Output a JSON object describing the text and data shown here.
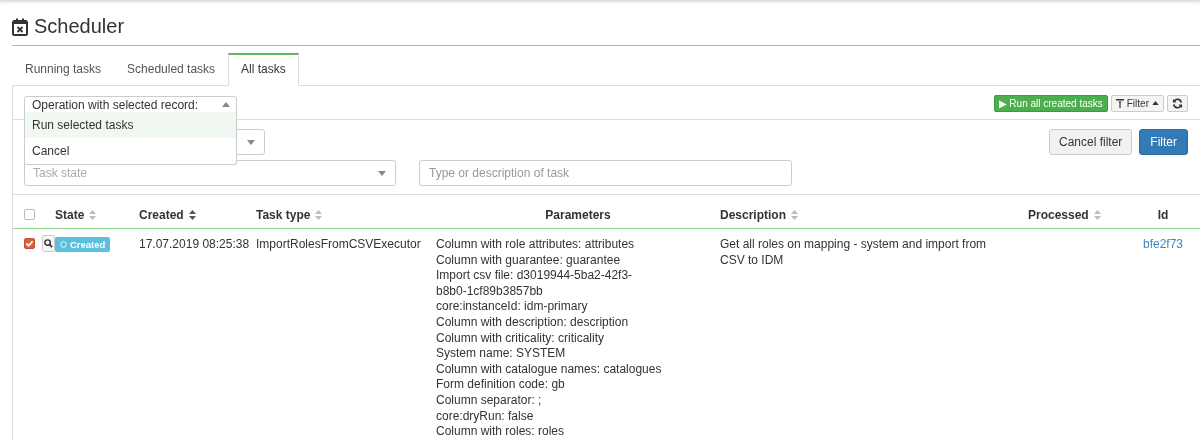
{
  "page": {
    "title": "Scheduler"
  },
  "tabs": [
    {
      "label": "Running tasks",
      "selected": false
    },
    {
      "label": "Scheduled tasks",
      "selected": false
    },
    {
      "label": "All tasks",
      "selected": true
    }
  ],
  "operation": {
    "label": "Operation with selected record:",
    "expanded": true,
    "options": [
      {
        "label": "Run selected tasks",
        "selected": true
      },
      {
        "label": "Cancel",
        "selected": false
      }
    ]
  },
  "toolbar": {
    "run_all": "▶ Run all created tasks",
    "filter_toggle": "Filter",
    "filter_expanded": true
  },
  "filter": {
    "task_state": {
      "placeholder": "Task state"
    },
    "text": {
      "placeholder": "Type or description of task"
    },
    "cancel": "Cancel filter",
    "apply": "Filter"
  },
  "table": {
    "columns": [
      {
        "label": "State",
        "sortable": true
      },
      {
        "label": "Created",
        "sortable": true
      },
      {
        "label": "Task type",
        "sortable": true
      },
      {
        "label": "Parameters",
        "sortable": false
      },
      {
        "label": "Description",
        "sortable": true
      },
      {
        "label": "Processed",
        "sortable": true
      },
      {
        "label": "Id",
        "sortable": false
      }
    ],
    "all_checked": false,
    "rows": [
      {
        "checked": true,
        "state": "Created",
        "created": "17.07.2019 08:25:38",
        "task_type": "ImportRolesFromCSVExecutor",
        "parameters": [
          "Column with role attributes: attributes",
          "Column with guarantee: guarantee",
          "Import csv file: d3019944-5ba2-42f3-b8b0-1cf89b3857bb",
          "core:instanceId: idm-primary",
          "Column with description: description",
          "Column with criticality: criticality",
          "System name: SYSTEM",
          "Column with catalogue names: catalogues",
          "Form definition code: gb",
          "Column separator: ;",
          "core:dryRun: false",
          "Column with roles: roles"
        ],
        "description": "Get all roles on mapping - system and import from CSV to IDM",
        "id": "bfe2f73"
      }
    ]
  }
}
